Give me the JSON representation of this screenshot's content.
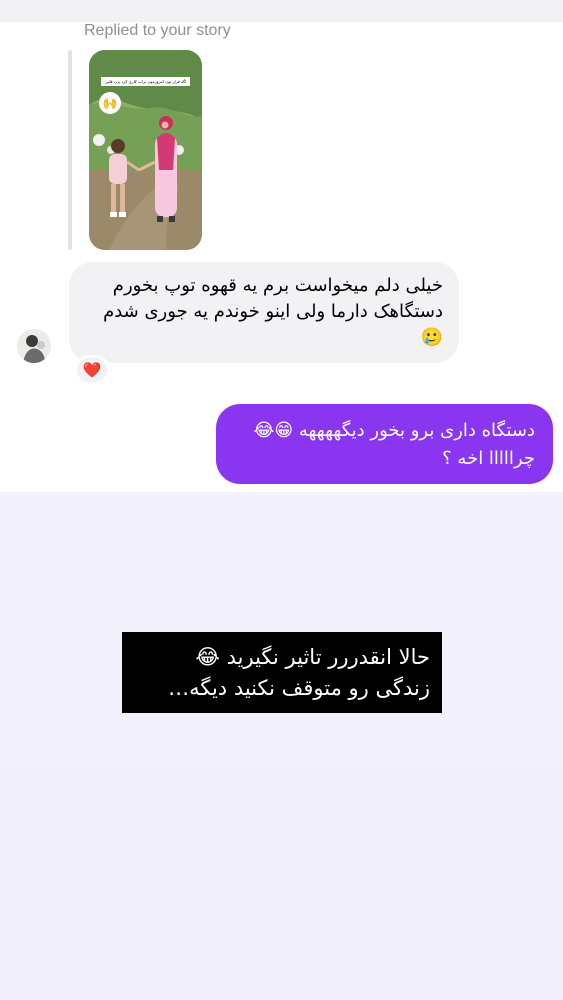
{
  "thread": {
    "replied_label": "Replied to your story",
    "story": {
      "caption": "اگه قرار نون امروزمون برات کاری کرد بزن قلبی",
      "sticker": "🙌"
    },
    "incoming": {
      "lines": [
        "خیلی دلم میخواست برم یه قهوه توپ بخورم",
        "دستگاهک دارما ولی اینو خوندم یه جوری شدم",
        "🥲"
      ],
      "reaction": "❤️"
    },
    "outgoing": {
      "lines": [
        "دستگاه داری برو بخور دیگههههه 😁😂",
        "چرااااا اخه ؟"
      ]
    }
  },
  "overlay": {
    "lines": [
      "حالا انقدررر تاثیر نگیرید 😂",
      "زندگی رو متوقف نکنید دیگه…"
    ]
  },
  "colors": {
    "outgoing_bubble": "#8a35f0",
    "incoming_bubble": "#f2f2f5",
    "lower_background": "#f0eefa"
  }
}
